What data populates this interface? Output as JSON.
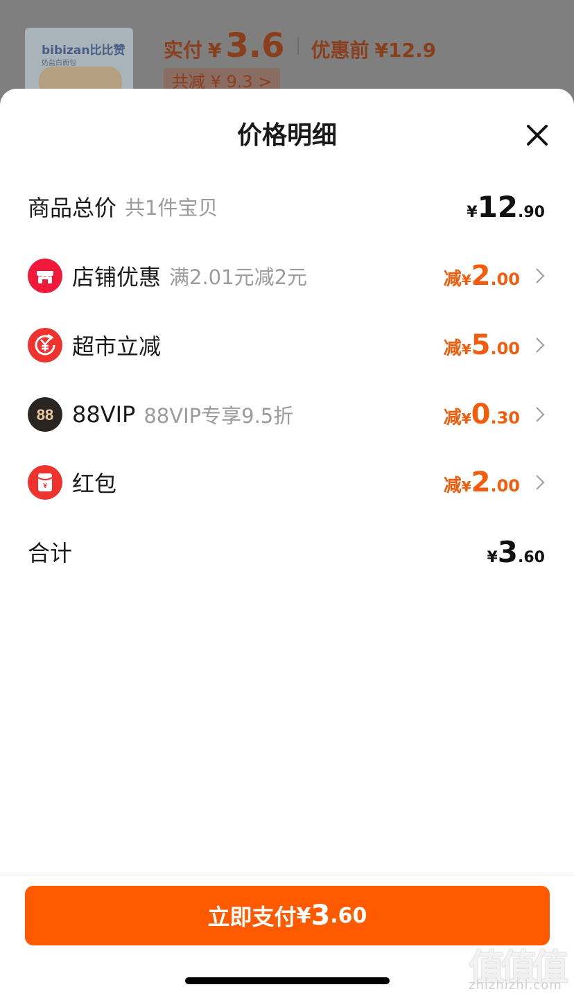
{
  "background_page": {
    "product_brand": "bibizan比比赞",
    "product_sub": "奶盐白面包",
    "paid_label": "实付",
    "currency": "¥",
    "paid_amount": "3.6",
    "before_label": "优惠前",
    "before_amount": "¥12.9",
    "total_discount": "共减 ¥ 9.3 >"
  },
  "sheet": {
    "title": "价格明细",
    "close_icon": "close-icon",
    "subtotal": {
      "label": "商品总价",
      "note": "共1件宝贝",
      "currency": "¥",
      "int": "12",
      "dec": ".90"
    },
    "discounts": [
      {
        "icon": "store-icon",
        "color": "#f0193a",
        "label": "店铺优惠",
        "note": "满2.01元减2元",
        "prefix": "减",
        "currency": "¥",
        "int": "2",
        "dec": ".00"
      },
      {
        "icon": "yuan-refresh-icon",
        "color": "#f0322f",
        "label": "超市立减",
        "note": "",
        "prefix": "减",
        "currency": "¥",
        "int": "5",
        "dec": ".00"
      },
      {
        "icon": "88vip-icon",
        "color": "#2b2522",
        "label": "88VIP",
        "note": "88VIP专享9.5折",
        "prefix": "减",
        "currency": "¥",
        "int": "0",
        "dec": ".30"
      },
      {
        "icon": "red-packet-icon",
        "color": "#f0322f",
        "label": "红包",
        "note": "",
        "prefix": "减",
        "currency": "¥",
        "int": "2",
        "dec": ".00"
      }
    ],
    "total": {
      "label": "合计",
      "currency": "¥",
      "int": "3",
      "dec": ".60"
    }
  },
  "pay_button": {
    "label": "立即支付",
    "currency": "¥",
    "int": "3",
    "dec": ".60"
  },
  "watermark": {
    "text": "值值值",
    "url": "zhizhizhi.com"
  },
  "colors": {
    "accent": "#ff5a00",
    "discount": "#f25c0c"
  }
}
